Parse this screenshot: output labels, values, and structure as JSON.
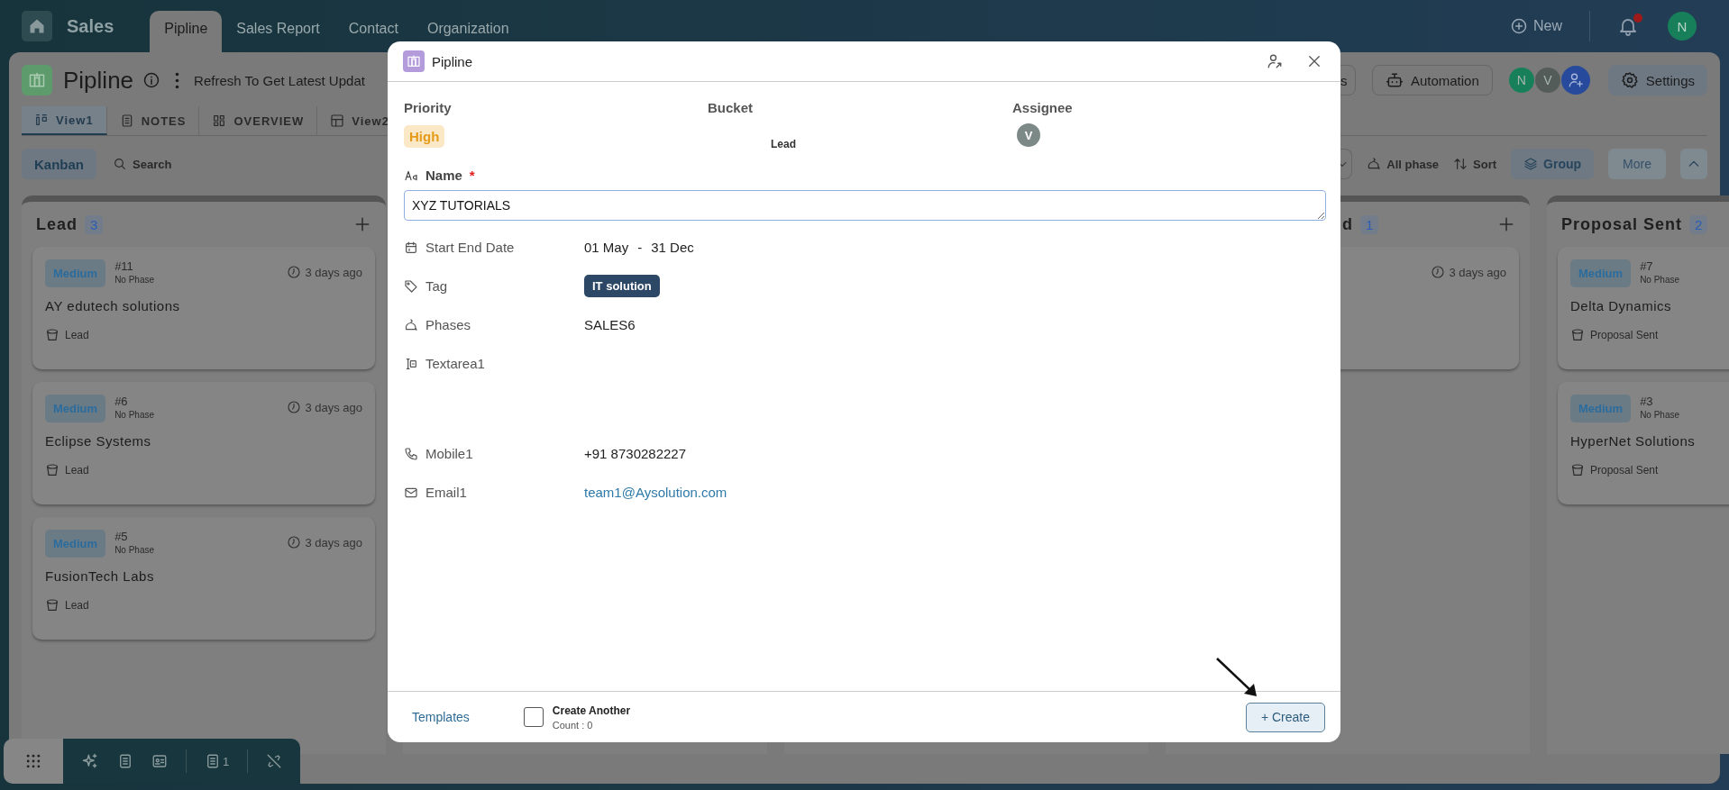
{
  "top_bar": {
    "app": "Sales",
    "tabs": [
      {
        "label": "Pipline",
        "selected": true
      },
      {
        "label": "Sales Report",
        "selected": false
      },
      {
        "label": "Contact",
        "selected": false
      },
      {
        "label": "Organization",
        "selected": false
      }
    ],
    "new_label": "New",
    "notification_dot": true,
    "user_initial": "N"
  },
  "page": {
    "title": "Pipline",
    "refresh_text": "Refresh To Get Latest Updat",
    "partial_button": "s",
    "automation": "Automation",
    "members": [
      {
        "initial": "N",
        "color": "#17805a"
      },
      {
        "initial": "V",
        "color": "#545c5a"
      }
    ],
    "settings": "Settings"
  },
  "views": [
    {
      "label": "View1",
      "kind": "board",
      "selected": true
    },
    {
      "label": "NOTES",
      "kind": "doc",
      "selected": false
    },
    {
      "label": "OVERVIEW",
      "kind": "grid",
      "selected": false
    },
    {
      "label": "View2",
      "kind": "table",
      "selected": false
    }
  ],
  "toolbar": {
    "layout": "Kanban",
    "search": "Search",
    "phase_filter": "All phase",
    "sort": "Sort",
    "group": "Group",
    "more": "More"
  },
  "columns": [
    {
      "kind": "full",
      "title": "Lead",
      "count": "3",
      "add_button": true,
      "cards": [
        {
          "priority": "Medium",
          "number": "#11",
          "phase": "No Phase",
          "time": "3 days ago",
          "name": "AY edutech solutions",
          "bucket": "Lead"
        },
        {
          "priority": "Medium",
          "number": "#6",
          "phase": "No Phase",
          "time": "3 days ago",
          "name": "Eclipse Systems",
          "bucket": "Lead"
        },
        {
          "priority": "Medium",
          "number": "#5",
          "phase": "No Phase",
          "time": "3 days ago",
          "name": "FusionTech Labs",
          "bucket": "Lead"
        }
      ]
    },
    {
      "kind": "hidden"
    },
    {
      "kind": "hidden"
    },
    {
      "kind": "partial",
      "title": "d",
      "count": "1",
      "add_button": true,
      "cards": [
        {
          "time": "3 days ago"
        }
      ]
    },
    {
      "kind": "full",
      "title": "Proposal Sent",
      "count": "2",
      "add_button": false,
      "cards": [
        {
          "priority": "Medium",
          "number": "#7",
          "phase": "No Phase",
          "name": "Delta Dynamics",
          "bucket": "Proposal Sent"
        },
        {
          "priority": "Medium",
          "number": "#3",
          "phase": "No Phase",
          "name": "HyperNet Solutions",
          "bucket": "Proposal Sent"
        }
      ]
    }
  ],
  "dock": {
    "doc_count": "1"
  },
  "modal": {
    "title": "Pipline",
    "priority": {
      "label": "Priority",
      "value": "High"
    },
    "bucket": {
      "label": "Bucket",
      "value": "Lead"
    },
    "assignee": {
      "label": "Assignee",
      "initial": "V"
    },
    "name": {
      "label": "Name",
      "required_mark": "*",
      "value": "XYZ TUTORIALS"
    },
    "fields": [
      {
        "kind": "date",
        "label": "Start End Date",
        "start": "01 May",
        "separator": "-",
        "end": "31 Dec"
      },
      {
        "kind": "tag",
        "label": "Tag",
        "value": "IT solution"
      },
      {
        "kind": "phase",
        "label": "Phases",
        "value": "SALES6"
      },
      {
        "kind": "textarea",
        "label": "Textarea1"
      },
      {
        "kind": "phone",
        "label": "Mobile1",
        "value": "+91 8730282227"
      },
      {
        "kind": "email",
        "label": "Email1",
        "value": "team1@Aysolution.com"
      }
    ],
    "footer": {
      "templates": "Templates",
      "create_another": {
        "label": "Create Another",
        "checked": false,
        "count": "Count : 0"
      },
      "create": "+ Create"
    }
  }
}
